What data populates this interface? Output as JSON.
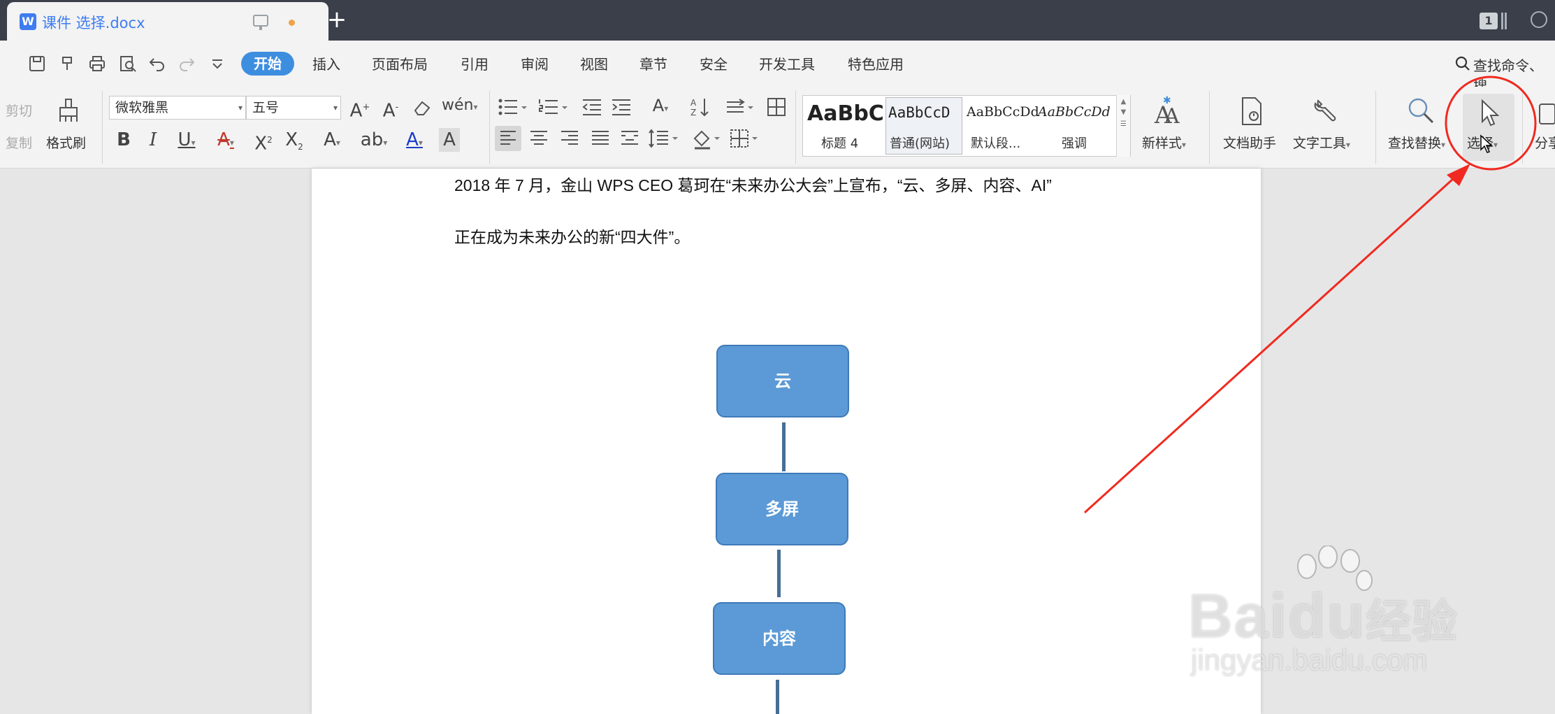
{
  "tab": {
    "title": "课件 选择.docx",
    "app_logo": "W"
  },
  "window": {
    "count": "1"
  },
  "menu": {
    "items": [
      "开始",
      "插入",
      "页面布局",
      "引用",
      "审阅",
      "视图",
      "章节",
      "安全",
      "开发工具",
      "特色应用"
    ],
    "search": "查找命令、搜"
  },
  "ribbon": {
    "cut": "剪切",
    "copy": "复制",
    "format_painter": "格式刷",
    "font_name": "微软雅黑",
    "font_size": "五号",
    "styles": [
      {
        "sample": "AaBbC",
        "name": "标题 4"
      },
      {
        "sample": "AaBbCcD",
        "name": "普通(网站)"
      },
      {
        "sample": "AaBbCcDd",
        "name": "默认段..."
      },
      {
        "sample": "AaBbCcDd",
        "name": "强调"
      }
    ],
    "new_style": "新样式",
    "doc_assistant": "文档助手",
    "text_tools": "文字工具",
    "find_replace": "查找替换",
    "select": "选择",
    "share": "分享"
  },
  "document": {
    "line1": "2018 年 7 月，金山 WPS CEO 葛珂在“未来办公大会”上宣布，“云、多屏、内容、AI”",
    "line2": "正在成为未来办公的新“四大件”。",
    "flow": [
      "云",
      "多屏",
      "内容"
    ]
  },
  "watermark": {
    "brand": "Bai",
    "brand2": "du",
    "brand_cn": "经验",
    "site": "jingyan.baidu.com"
  },
  "colors": {
    "accent": "#3e8ee0",
    "titlebar": "#3a3f4a",
    "flow_box": "#5b9ad6",
    "annotation": "#f02a20"
  }
}
